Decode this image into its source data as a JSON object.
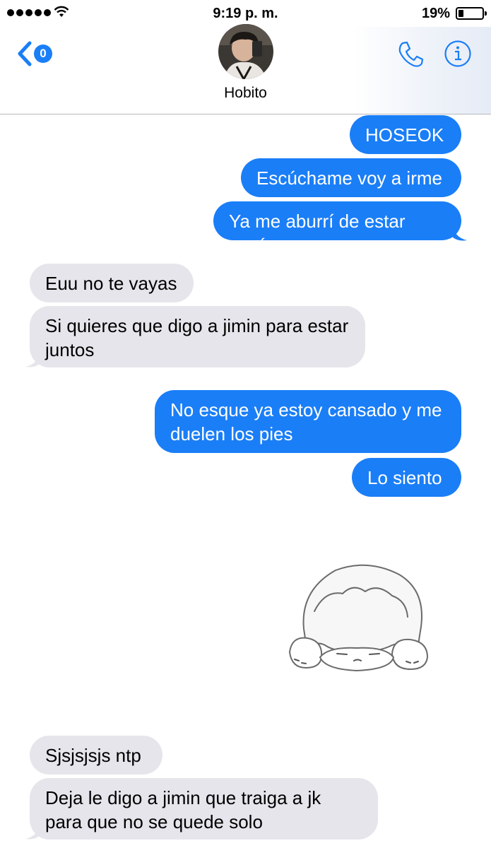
{
  "status_bar": {
    "time": "9:19 p. m.",
    "battery": "19%",
    "battery_level": 0.19
  },
  "nav": {
    "back_icon": "chevron-left-icon",
    "back_badge": "0",
    "contact_name": "Hobito",
    "phone_icon": "phone-icon",
    "info_icon": "info-icon"
  },
  "messages": [
    {
      "from": "me",
      "text": "HOSEOK"
    },
    {
      "from": "me",
      "text": "Escúchame voy a irme"
    },
    {
      "from": "me",
      "text": "Ya me aburrí de estar aquí"
    },
    {
      "from": "them",
      "text": "Euu no te vayas"
    },
    {
      "from": "them",
      "text": "Si quieres que digo a jimin para estar juntos"
    },
    {
      "from": "me",
      "text": "No esque ya estoy cansado y me duelen los pies"
    },
    {
      "from": "me",
      "text": "Lo siento"
    },
    {
      "from": "me",
      "sticker": "sleepy-white-creature-sticker"
    },
    {
      "from": "them",
      "text": "Sjsjsjsjs ntp"
    },
    {
      "from": "them",
      "text": "Deja le digo a jimin que traiga a jk para que no se quede solo"
    }
  ],
  "colors": {
    "sent_bubble": "#1a7ef7",
    "received_bubble": "#e6e5eb",
    "accent": "#1a7ef7"
  }
}
